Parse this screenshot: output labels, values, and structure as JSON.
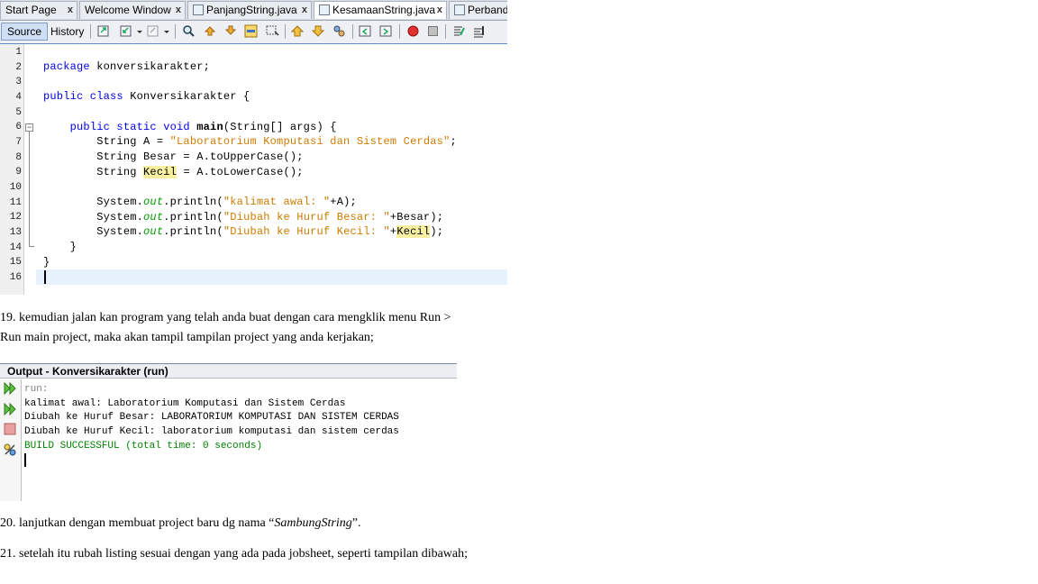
{
  "editor": {
    "tabs": [
      {
        "label": "Start Page",
        "active": false,
        "icon": false
      },
      {
        "label": "Welcome Window",
        "active": false,
        "icon": false
      },
      {
        "label": "PanjangString.java",
        "active": false,
        "icon": true
      },
      {
        "label": "KesamaanString.java",
        "active": true,
        "icon": true
      },
      {
        "label": "Perbandin",
        "active": false,
        "icon": true
      }
    ],
    "toolbar": {
      "source_label": "Source",
      "history_label": "History"
    },
    "line_numbers": [
      "1",
      "2",
      "3",
      "4",
      "5",
      "6",
      "7",
      "8",
      "9",
      "10",
      "11",
      "12",
      "13",
      "14",
      "15",
      "16"
    ],
    "code": {
      "l2_kw": "package",
      "l2_rest": " konversikarakter;",
      "l4_kw": "public class",
      "l4_rest": " Konversikarakter {",
      "l6_indent": "    ",
      "l6_kw": "public static void",
      "l6_sp": " ",
      "l6_name": "main",
      "l6_rest": "(String[] args) {",
      "l7_pre": "        String A = ",
      "l7_str": "\"Laboratorium Komputasi dan Sistem Cerdas\"",
      "l7_end": ";",
      "l8": "        String Besar = A.toUpperCase();",
      "l9_pre": "        String ",
      "l9_hl": "Kecil",
      "l9_end": " = A.toLowerCase();",
      "l11_pre": "        System.",
      "l11_out": "out",
      "l11_mid": ".println(",
      "l11_str": "\"kalimat awal: \"",
      "l11_end": "+A);",
      "l12_pre": "        System.",
      "l12_out": "out",
      "l12_mid": ".println(",
      "l12_str": "\"Diubah ke Huruf Besar: \"",
      "l12_end": "+Besar);",
      "l13_pre": "        System.",
      "l13_out": "out",
      "l13_mid": ".println(",
      "l13_str": "\"Diubah ke Huruf Kecil: \"",
      "l13_plus": "+",
      "l13_hl": "Kecil",
      "l13_end": ");",
      "l14": "    }",
      "l15": "}"
    }
  },
  "doc": {
    "p19_line1": "19. kemudian jalan kan program yang telah anda buat dengan cara mengklik menu Run >",
    "p19_line2": "Run main project, maka akan tampil tampilan project yang anda kerjakan;",
    "p20_pre": "20. lanjutkan dengan membuat project baru dg nama  “",
    "p20_name": "SambungString",
    "p20_post": "”.",
    "p21": "21. setelah itu rubah listing sesuai dengan yang ada pada jobsheet, seperti tampilan dibawah;"
  },
  "output": {
    "title": "Output - Konversikarakter (run)",
    "lines": [
      "run:",
      "kalimat awal: Laboratorium Komputasi dan Sistem Cerdas",
      "Diubah ke Huruf Besar: LABORATORIUM KOMPUTASI DAN SISTEM CERDAS",
      "Diubah ke Huruf Kecil: laboratorium komputasi dan sistem cerdas",
      "BUILD SUCCESSFUL (total time: 0 seconds)"
    ],
    "colors": {
      "run": "#808080",
      "build": "#008000",
      "normal": "#000000"
    }
  }
}
